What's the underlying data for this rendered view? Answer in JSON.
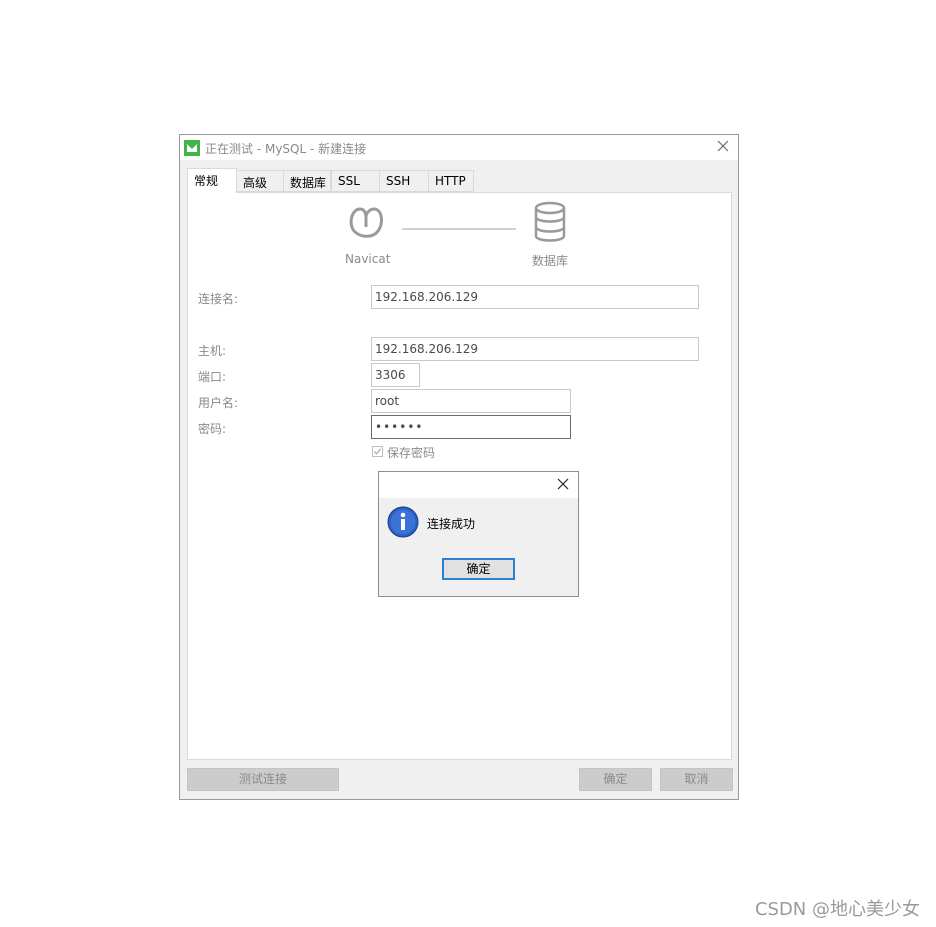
{
  "window": {
    "title": "正在测试 - MySQL - 新建连接",
    "tabs": [
      "常规",
      "高级",
      "数据库",
      "SSL",
      "SSH",
      "HTTP"
    ],
    "active_tab": "常规"
  },
  "diagram": {
    "left_label": "Navicat",
    "right_label": "数据库"
  },
  "form": {
    "connection_name_label": "连接名:",
    "connection_name_value": "192.168.206.129",
    "host_label": "主机:",
    "host_value": "192.168.206.129",
    "port_label": "端口:",
    "port_value": "3306",
    "username_label": "用户名:",
    "username_value": "root",
    "password_label": "密码:",
    "password_value": "••••••",
    "save_password_label": "保存密码",
    "save_password_checked": true
  },
  "buttons": {
    "test": "测试连接",
    "ok": "确定",
    "cancel": "取消"
  },
  "message_dialog": {
    "message": "连接成功",
    "ok": "确定"
  },
  "watermark": "CSDN @地心美少女",
  "colors": {
    "app_icon_green": "#3cb54a",
    "info_blue": "#2a5fc4",
    "focus_blue": "#2d7fd3"
  }
}
